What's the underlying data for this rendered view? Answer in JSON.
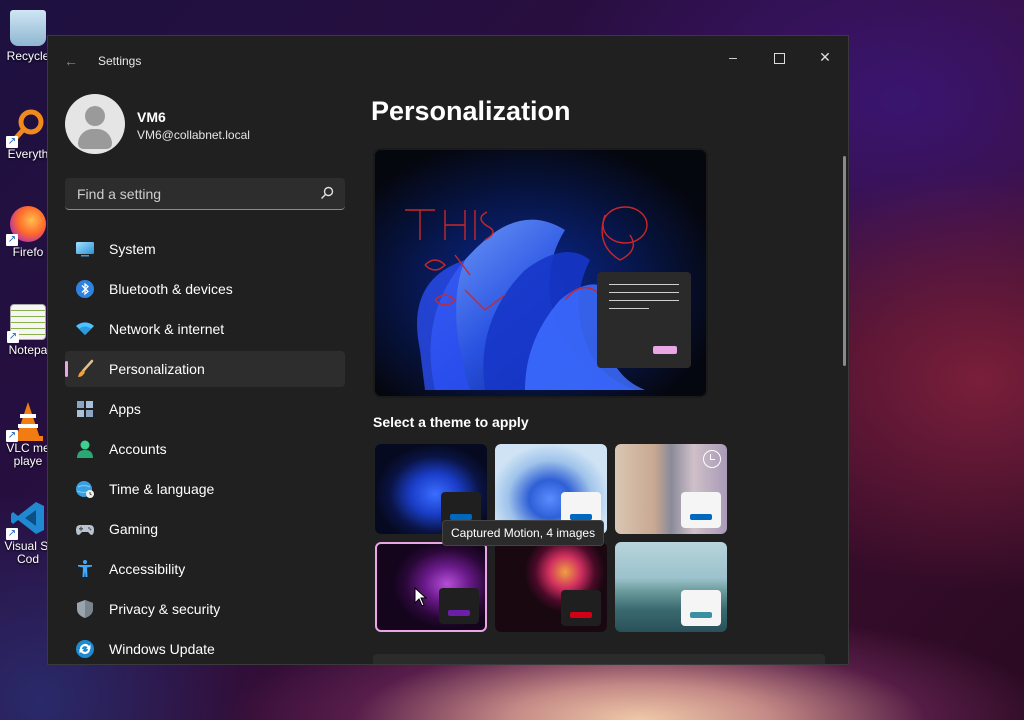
{
  "desktop": {
    "icons": [
      {
        "label": "Recycle",
        "icon": "recycle-bin-icon"
      },
      {
        "label": "Everyth",
        "icon": "everything-search-icon"
      },
      {
        "label": "Firefo",
        "icon": "firefox-icon"
      },
      {
        "label": "Notepa",
        "icon": "notepad-icon"
      },
      {
        "label": "VLC me playe",
        "icon": "vlc-icon"
      },
      {
        "label": "Visual St Cod",
        "icon": "vscode-icon"
      }
    ]
  },
  "window": {
    "title": "Settings",
    "controls": {
      "minimize": "–",
      "close": "✕"
    }
  },
  "user": {
    "name": "VM6",
    "email": "VM6@collabnet.local"
  },
  "search": {
    "placeholder": "Find a setting"
  },
  "nav": {
    "items": [
      {
        "label": "System",
        "icon": "system-icon"
      },
      {
        "label": "Bluetooth & devices",
        "icon": "bluetooth-icon"
      },
      {
        "label": "Network & internet",
        "icon": "wifi-icon"
      },
      {
        "label": "Personalization",
        "icon": "brush-icon",
        "active": true
      },
      {
        "label": "Apps",
        "icon": "apps-icon"
      },
      {
        "label": "Accounts",
        "icon": "accounts-icon"
      },
      {
        "label": "Time & language",
        "icon": "globe-clock-icon"
      },
      {
        "label": "Gaming",
        "icon": "gamepad-icon"
      },
      {
        "label": "Accessibility",
        "icon": "accessibility-icon"
      },
      {
        "label": "Privacy & security",
        "icon": "shield-icon"
      },
      {
        "label": "Windows Update",
        "icon": "windows-update-icon"
      }
    ]
  },
  "main": {
    "title": "Personalization",
    "section_label": "Select a theme to apply",
    "tooltip": "Captured Motion, 4 images",
    "themes": [
      {
        "name": "windows-dark",
        "accent": "#0067c0"
      },
      {
        "name": "windows-light",
        "accent": "#0067c0"
      },
      {
        "name": "spotlight",
        "accent": "#0067c0"
      },
      {
        "name": "glow",
        "accent": "#6b1fa8",
        "selected": true
      },
      {
        "name": "captured-motion",
        "accent": "#d10014"
      },
      {
        "name": "flow",
        "accent": "#3a8fa0"
      }
    ]
  },
  "colors": {
    "accent_pink": "#e8a7e4",
    "window_bg": "#202020"
  }
}
